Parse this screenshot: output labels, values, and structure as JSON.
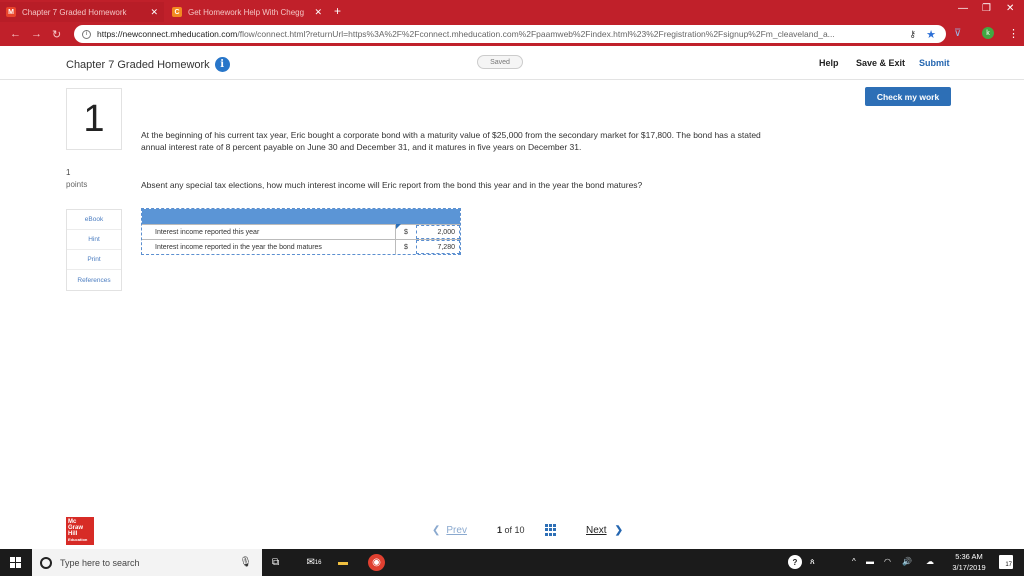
{
  "browser": {
    "tabs": [
      {
        "label": "Chapter 7 Graded Homework",
        "close": "✕"
      },
      {
        "label": "Get Homework Help With Chegg",
        "close": "✕"
      }
    ],
    "new_tab": "+",
    "url_host": "https://newconnect.mheducation.com",
    "url_rest": "/flow/connect.html?returnUrl=https%3A%2F%2Fconnect.mheducation.com%2Fpaamweb%2Findex.html%23%2Fregistration%2Fsignup%2Fm_cleaveland_a...",
    "profile_initial": "k"
  },
  "header": {
    "title": "Chapter 7 Graded Homework",
    "saved": "Saved",
    "help": "Help",
    "save_exit": "Save & Exit",
    "submit": "Submit",
    "info_glyph": "i"
  },
  "question": {
    "check_label": "Check my work",
    "number": "1",
    "points_value": "1",
    "points_label": "points",
    "side_links": [
      "eBook",
      "Hint",
      "Print",
      "References"
    ],
    "text": "At the beginning of his current tax year, Eric bought a corporate bond with a maturity value of $25,000 from the secondary market for $17,800. The bond has a stated annual interest rate of 8 percent payable on June 30 and December 31, and it matures in five years on December 31.",
    "ask": "Absent any special tax elections, how much interest income will Eric report from the bond this year and in the year the bond matures?",
    "rows": [
      {
        "label": "Interest income reported this year",
        "currency": "$",
        "value": "2,000"
      },
      {
        "label": "Interest income reported in the year the bond matures",
        "currency": "$",
        "value": "7,280"
      }
    ]
  },
  "footer": {
    "logo_lines": [
      "Mc",
      "Graw",
      "Hill",
      "Education"
    ],
    "prev": "Prev",
    "page_current": "1",
    "page_of": "of 10",
    "next": "Next"
  },
  "taskbar": {
    "search_placeholder": "Type here to search",
    "time": "5:36 AM",
    "date": "3/17/2019",
    "notifications": "17",
    "mail_badge": "16"
  }
}
